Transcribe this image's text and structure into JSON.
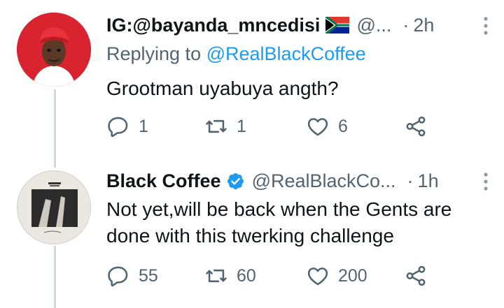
{
  "colors": {
    "text": "#0f1419",
    "secondary": "#536471",
    "accent": "#1d9bf0",
    "thread_line": "#cfd9de",
    "flag_green": "#007a4d",
    "flag_red": "#de3831",
    "flag_blue": "#002395",
    "flag_gold": "#ffb612"
  },
  "tweets": [
    {
      "display_name": "IG:@bayanda_mncedisi",
      "handle": "@...",
      "separator": "·",
      "time": "2h",
      "replying_prefix": "Replying to",
      "replying_to": "@RealBlackCoffee",
      "text": "Grootman uyabuya angth?",
      "replies": "1",
      "retweets": "1",
      "likes": "6"
    },
    {
      "display_name": "Black Coffee",
      "handle": "@RealBlackCo...",
      "separator": "·",
      "time": "1h",
      "text": "Not yet,will be back when the Gents are done with this twerking challenge",
      "replies": "55",
      "retweets": "60",
      "likes": "200"
    }
  ]
}
